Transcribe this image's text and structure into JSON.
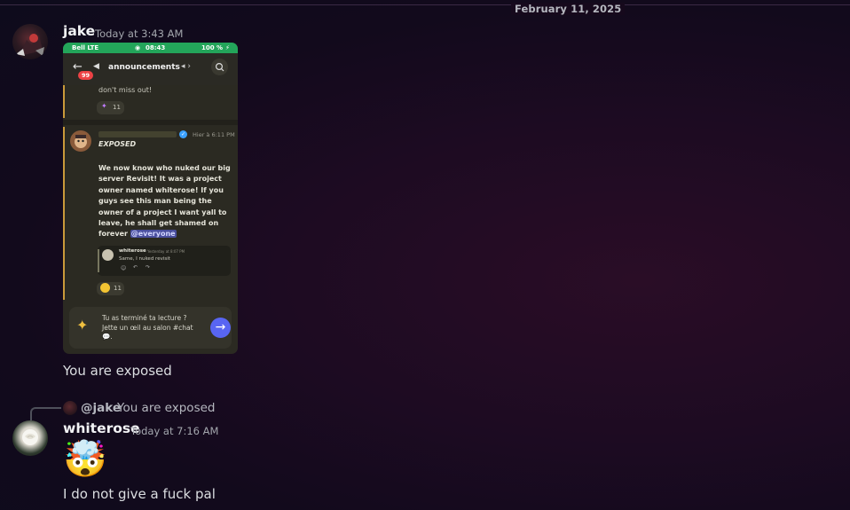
{
  "date_divider": "February 11, 2025",
  "messages": [
    {
      "username": "jake",
      "timestamp": "Today at 3:43 AM",
      "text": "You are exposed",
      "attachment": {
        "status_carrier": "Bell  LTE",
        "status_time": "08:43",
        "status_battery": "100 %",
        "channel": "announcements",
        "unread_badge": "99",
        "prev_text": "don't miss out!",
        "prev_reaction_count": "11",
        "post_time": "Hier à 6:11 PM",
        "post_heading": "EXPOSED",
        "post_body": "We now know who nuked our big server Revisit! It was a project owner named whiterose! If you guys see this man being the owner of a project I want yall to leave, he shall get shamed on forever",
        "post_mention": "@everyone",
        "embed_user": "whiterose",
        "embed_time": "Yesterday at 8:07 PM",
        "embed_text": "Same, I nuked revisit",
        "post_reaction_count": "11",
        "banner_line1": "Tu as terminé ta lecture ?",
        "banner_line2": "Jette un œil au salon #chat",
        "banner_emoji": "💬."
      }
    },
    {
      "reply_to_user": "@jake",
      "reply_to_text": "You are exposed",
      "username": "whiterose",
      "timestamp": "Today at 7:16 AM",
      "emoji": "🤯",
      "text": "I do not give a fuck pal"
    }
  ],
  "colors": {
    "green_status": "#23a55a",
    "blurple": "#5865f2",
    "quote_gold": "#c99a3a",
    "verified_blue": "#3ba1ff"
  }
}
